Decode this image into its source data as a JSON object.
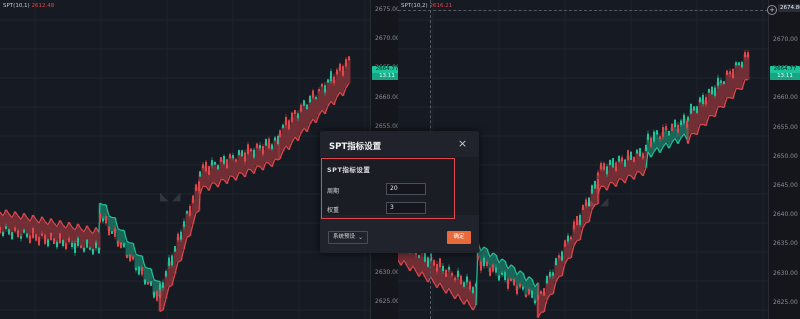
{
  "left_chart": {
    "indicator_label": "SPT(10,1)",
    "indicator_value": "2612.48",
    "ticks": [
      "2675.00",
      "2670.00",
      "2665.00",
      "2660.00",
      "2655.00",
      "2650.00",
      "2645.00",
      "2640.00",
      "2635.00",
      "2630.00",
      "2625.00"
    ],
    "last_price": "2664.77",
    "countdown": "13:11"
  },
  "right_chart": {
    "indicator_label": "SPT(10,2)",
    "indicator_value": "2616.21",
    "ticks": [
      "2670.00",
      "2665.00",
      "2660.00",
      "2655.00",
      "2650.00",
      "2645.00",
      "2640.00",
      "2635.00",
      "2630.00",
      "2625.00"
    ],
    "crosshair_price": "2674.80",
    "last_price": "2664.77",
    "countdown": "13:11"
  },
  "modal": {
    "title": "SPT指标设置",
    "close_glyph": "×",
    "section_label": "SPT指标设置",
    "fields": [
      {
        "label": "周期",
        "value": "20"
      },
      {
        "label": "权重",
        "value": "3"
      }
    ],
    "preset_label": "系统预设",
    "confirm_label": "确定"
  },
  "icons": {
    "close": "close-icon",
    "chevron": "chevron-down-icon",
    "zoom": "plus-circle-icon"
  },
  "colors": {
    "bull": "#1ec39b",
    "bear": "#e0474c",
    "confirm": "#e86a3a"
  }
}
